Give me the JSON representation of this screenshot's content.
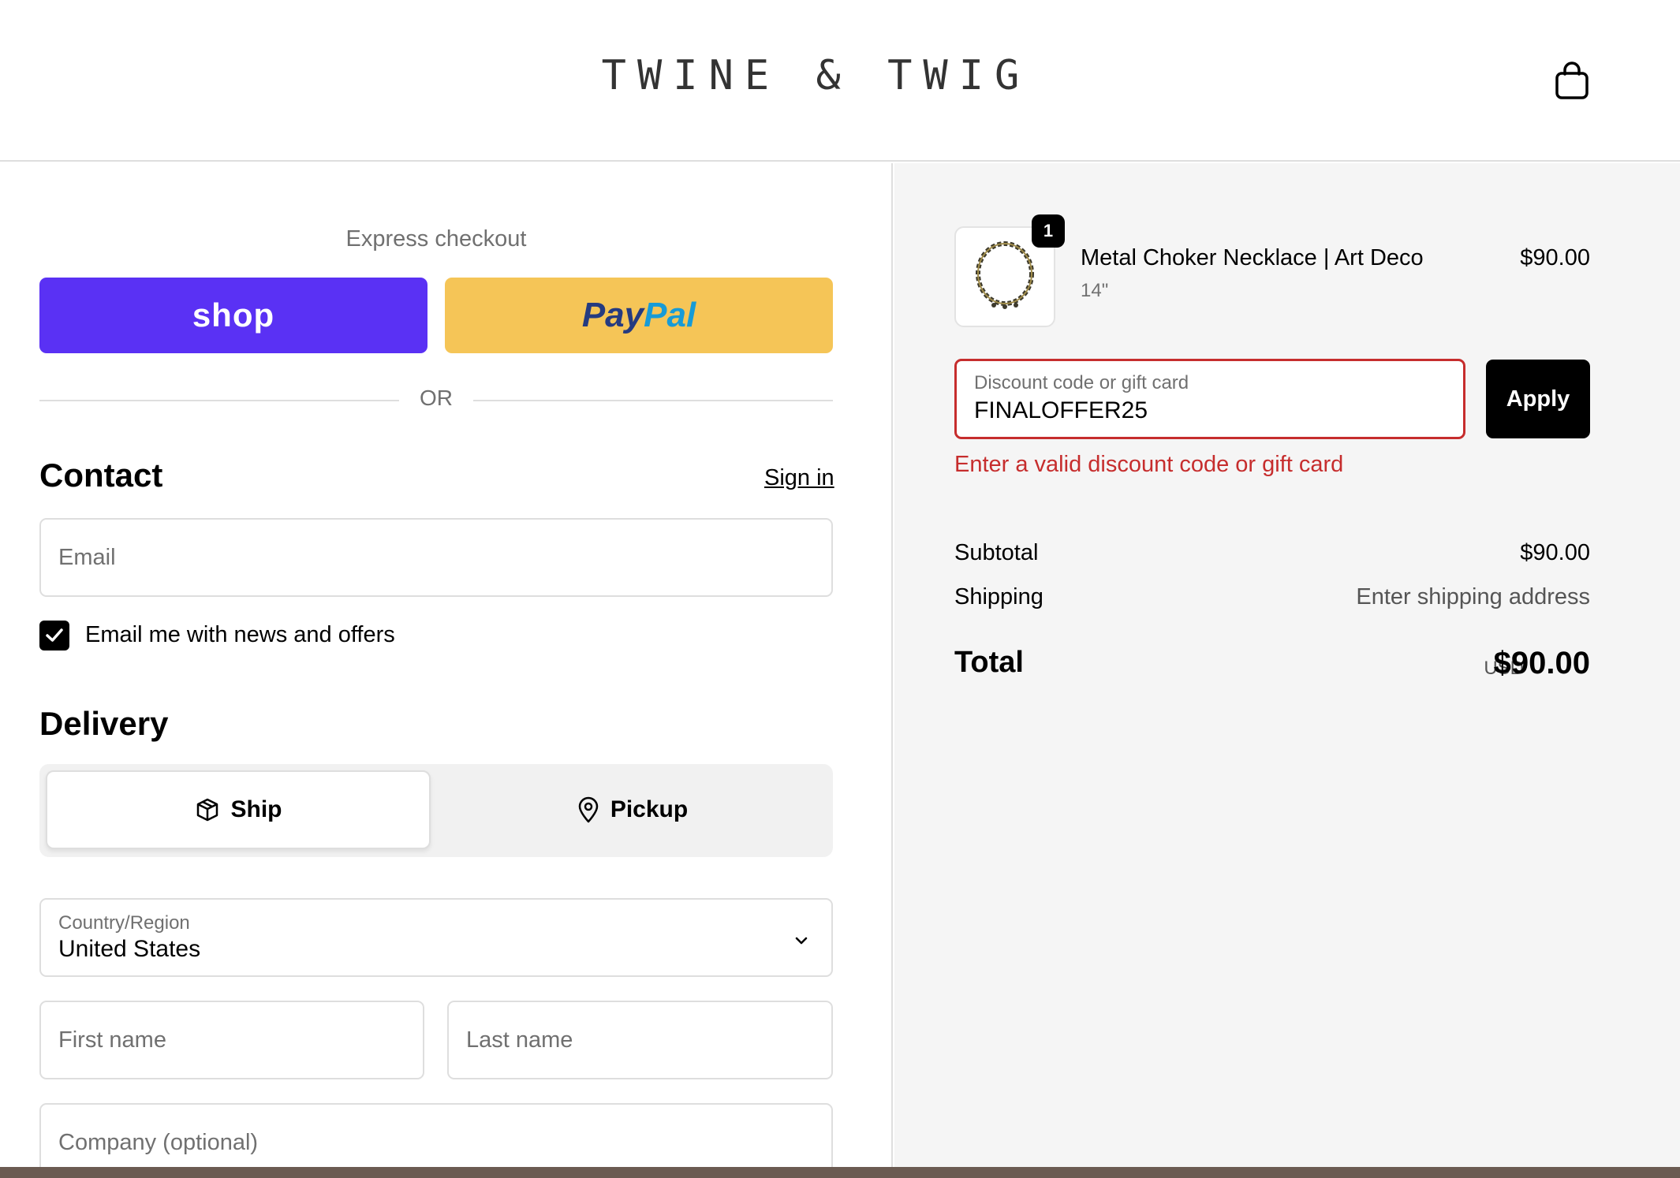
{
  "header": {
    "logo": "TWINE & TWIG",
    "cart_icon": "shopping-bag-icon"
  },
  "checkout": {
    "express_label": "Express checkout",
    "shop_pay_label": "shop",
    "paypal_label_a": "Pay",
    "paypal_label_b": "Pal",
    "or_label": "OR"
  },
  "contact": {
    "heading": "Contact",
    "sign_in": "Sign in",
    "email_placeholder": "Email",
    "newsletter_label": "Email me with news and offers",
    "newsletter_checked": true
  },
  "delivery": {
    "heading": "Delivery",
    "options": [
      {
        "label": "Ship",
        "icon": "package-icon",
        "selected": true
      },
      {
        "label": "Pickup",
        "icon": "location-pin-icon",
        "selected": false
      }
    ],
    "country_label": "Country/Region",
    "country_value": "United States",
    "first_name_placeholder": "First name",
    "last_name_placeholder": "Last name",
    "company_placeholder": "Company (optional)"
  },
  "order": {
    "item": {
      "name": "Metal Choker Necklace | Art Deco",
      "variant": "14\"",
      "price": "$90.00",
      "quantity": "1"
    },
    "discount_label": "Discount code or gift card",
    "discount_value": "FINALOFFER25",
    "apply_label": "Apply",
    "error": "Enter a valid discount code or gift card",
    "subtotal_label": "Subtotal",
    "subtotal_value": "$90.00",
    "shipping_label": "Shipping",
    "shipping_value": "Enter shipping address",
    "total_label": "Total",
    "total_currency": "USD",
    "total_value": "$90.00"
  },
  "colors": {
    "shop_pay": "#5a31f4",
    "paypal": "#f5c557",
    "error": "#c62d2d"
  }
}
